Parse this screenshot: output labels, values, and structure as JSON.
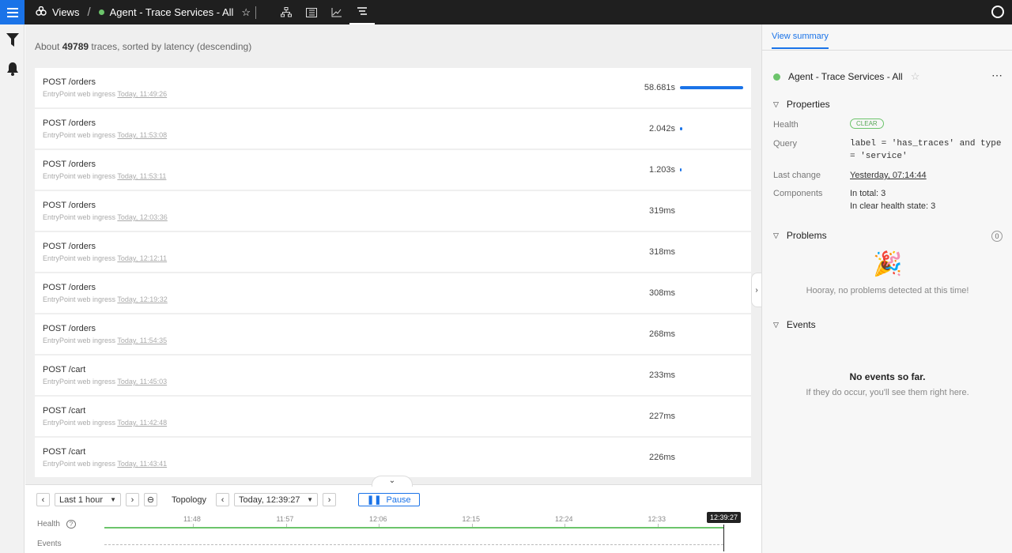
{
  "topbar": {
    "views_label": "Views",
    "view_name": "Agent - Trace Services - All"
  },
  "main": {
    "summary_prefix": "About",
    "summary_count": "49789",
    "summary_suffix": "traces, sorted by latency (descending)",
    "rows": [
      {
        "name": "POST /orders",
        "source": "EntryPoint web ingress",
        "time": "Today, 11:49:26",
        "duration": "58.681s",
        "latency_fraction": 1.0
      },
      {
        "name": "POST /orders",
        "source": "EntryPoint web ingress",
        "time": "Today, 11:53:08",
        "duration": "2.042s",
        "latency_fraction": 0.035
      },
      {
        "name": "POST /orders",
        "source": "EntryPoint web ingress",
        "time": "Today, 11:53:11",
        "duration": "1.203s",
        "latency_fraction": 0.02
      },
      {
        "name": "POST /orders",
        "source": "EntryPoint web ingress",
        "time": "Today, 12:03:36",
        "duration": "319ms",
        "latency_fraction": 0
      },
      {
        "name": "POST /orders",
        "source": "EntryPoint web ingress",
        "time": "Today, 12:12:11",
        "duration": "318ms",
        "latency_fraction": 0
      },
      {
        "name": "POST /orders",
        "source": "EntryPoint web ingress",
        "time": "Today, 12:19:32",
        "duration": "308ms",
        "latency_fraction": 0
      },
      {
        "name": "POST /orders",
        "source": "EntryPoint web ingress",
        "time": "Today, 11:54:35",
        "duration": "268ms",
        "latency_fraction": 0
      },
      {
        "name": "POST /cart",
        "source": "EntryPoint web ingress",
        "time": "Today, 11:45:03",
        "duration": "233ms",
        "latency_fraction": 0
      },
      {
        "name": "POST /cart",
        "source": "EntryPoint web ingress",
        "time": "Today, 11:42:48",
        "duration": "227ms",
        "latency_fraction": 0
      },
      {
        "name": "POST /cart",
        "source": "EntryPoint web ingress",
        "time": "Today, 11:43:41",
        "duration": "226ms",
        "latency_fraction": 0
      }
    ]
  },
  "timeline": {
    "range": "Last 1 hour",
    "mode_label": "Topology",
    "current_time": "Today, 12:39:27",
    "pause_label": "Pause",
    "health_label": "Health",
    "events_label": "Events",
    "ticks": [
      "11:48",
      "11:57",
      "12:06",
      "12:15",
      "12:24",
      "12:33"
    ],
    "now_badge": "12:39:27"
  },
  "panel": {
    "tab": "View summary",
    "view_name": "Agent - Trace Services - All",
    "properties_title": "Properties",
    "health_key": "Health",
    "health_value": "CLEAR",
    "query_key": "Query",
    "query_value": "label = 'has_traces' and type = 'service'",
    "last_change_key": "Last change",
    "last_change_value": "Yesterday, 07:14:44",
    "components_key": "Components",
    "components_total": "In total: 3",
    "components_clear": "In clear health state: 3",
    "problems_title": "Problems",
    "problems_count": "0",
    "problems_empty": "Hooray, no problems detected at this time!",
    "events_title": "Events",
    "events_empty_title": "No events so far.",
    "events_empty_sub": "If they do occur, you'll see them right here."
  },
  "colors": {
    "accent": "#1a73e8",
    "healthy": "#6cc46b",
    "topbar": "#1f1f1f"
  }
}
